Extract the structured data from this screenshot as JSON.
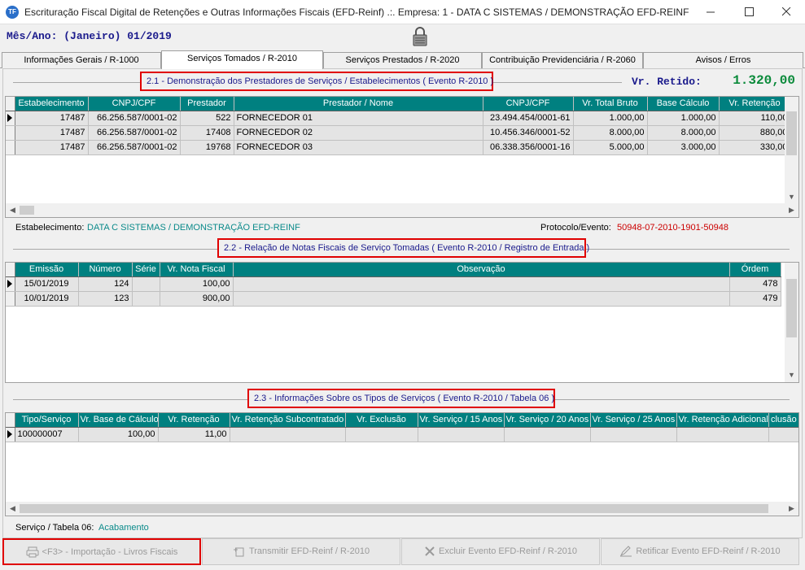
{
  "window": {
    "icon_text": "TF",
    "title": "Escrituração Fiscal Digital de Retenções e Outras Informações Fiscais (EFD-Reinf) .:. Empresa: 1 - DATA C SISTEMAS / DEMONSTRAÇÃO EFD-REINF"
  },
  "header": {
    "mes_ano": "Mês/Ano: (Janeiro) 01/2019"
  },
  "tabs": [
    {
      "label": "Informações Gerais / R-1000",
      "active": false
    },
    {
      "label": "Serviços Tomados / R-2010",
      "active": true
    },
    {
      "label": "Serviços Prestados / R-2020",
      "active": false
    },
    {
      "label": "Contribuição Previdenciária / R-2060",
      "active": false
    },
    {
      "label": "Avisos / Erros",
      "active": false
    }
  ],
  "section1": {
    "title": "2.1 - Demonstração dos Prestadores de Serviços / Estabelecimentos ( Evento R-2010 )",
    "vr_retido_label": "Vr. Retido:",
    "vr_retido_value": "1.320,00",
    "columns": [
      "Estabelecimento",
      "CNPJ/CPF",
      "Prestador",
      "Prestador / Nome",
      "CNPJ/CPF",
      "Vr. Total Bruto",
      "Base Cálculo",
      "Vr. Retenção"
    ],
    "rows": [
      [
        "17487",
        "66.256.587/0001-02",
        "522",
        "FORNECEDOR 01",
        "23.494.454/0001-61",
        "1.000,00",
        "1.000,00",
        "110,00"
      ],
      [
        "17487",
        "66.256.587/0001-02",
        "17408",
        "FORNECEDOR 02",
        "10.456.346/0001-52",
        "8.000,00",
        "8.000,00",
        "880,00"
      ],
      [
        "17487",
        "66.256.587/0001-02",
        "19768",
        "FORNECEDOR 03",
        "06.338.356/0001-16",
        "5.000,00",
        "3.000,00",
        "330,00"
      ]
    ],
    "estabelecimento_label": "Estabelecimento:",
    "estabelecimento_value": "DATA C SISTEMAS / DEMONSTRAÇÃO EFD-REINF",
    "protocolo_label": "Protocolo/Evento:",
    "protocolo_value": "50948-07-2010-1901-50948"
  },
  "section2": {
    "title": "2.2 - Relação de Notas Fiscais de Serviço Tomadas ( Evento R-2010 / Registro de Entrada )",
    "columns": [
      "Emissão",
      "Número",
      "Série",
      "Vr. Nota Fiscal",
      "Observação",
      "Órdem"
    ],
    "rows": [
      [
        "15/01/2019",
        "124",
        "",
        "100,00",
        "",
        "478"
      ],
      [
        "10/01/2019",
        "123",
        "",
        "900,00",
        "",
        "479"
      ]
    ]
  },
  "section3": {
    "title": "2.3 - Informações Sobre os Tipos de Serviços  ( Evento R-2010 / Tabela 06 )",
    "columns": [
      "Tipo/Serviço",
      "Vr. Base de Cálculo",
      "Vr. Retenção",
      "Vr. Retenção Subcontratado",
      "Vr. Exclusão",
      "Vr. Serviço / 15 Anos",
      "Vr. Serviço / 20 Anos",
      "Vr. Serviço / 25 Anos",
      "Vr. Retenção Adicional",
      "clusão Ac"
    ],
    "rows": [
      [
        "100000007",
        "100,00",
        "11,00",
        "",
        "",
        "",
        "",
        "",
        "",
        ""
      ]
    ],
    "servico_label": "Serviço / Tabela 06:",
    "servico_value": "Acabamento"
  },
  "buttons": {
    "importacao": "<F3> - Importação - Livros Fiscais",
    "transmitir": "Transmitir EFD-Reinf / R-2010",
    "excluir": "Excluir Evento EFD-Reinf / R-2010",
    "retificar": "Retificar Evento EFD-Reinf / R-2010"
  },
  "colors": {
    "grid_header": "#008080",
    "highlight_border": "#e00000",
    "label_blue": "#1a1a8c",
    "value_green": "#0a8a3a",
    "protocol_red": "#cc0000"
  }
}
